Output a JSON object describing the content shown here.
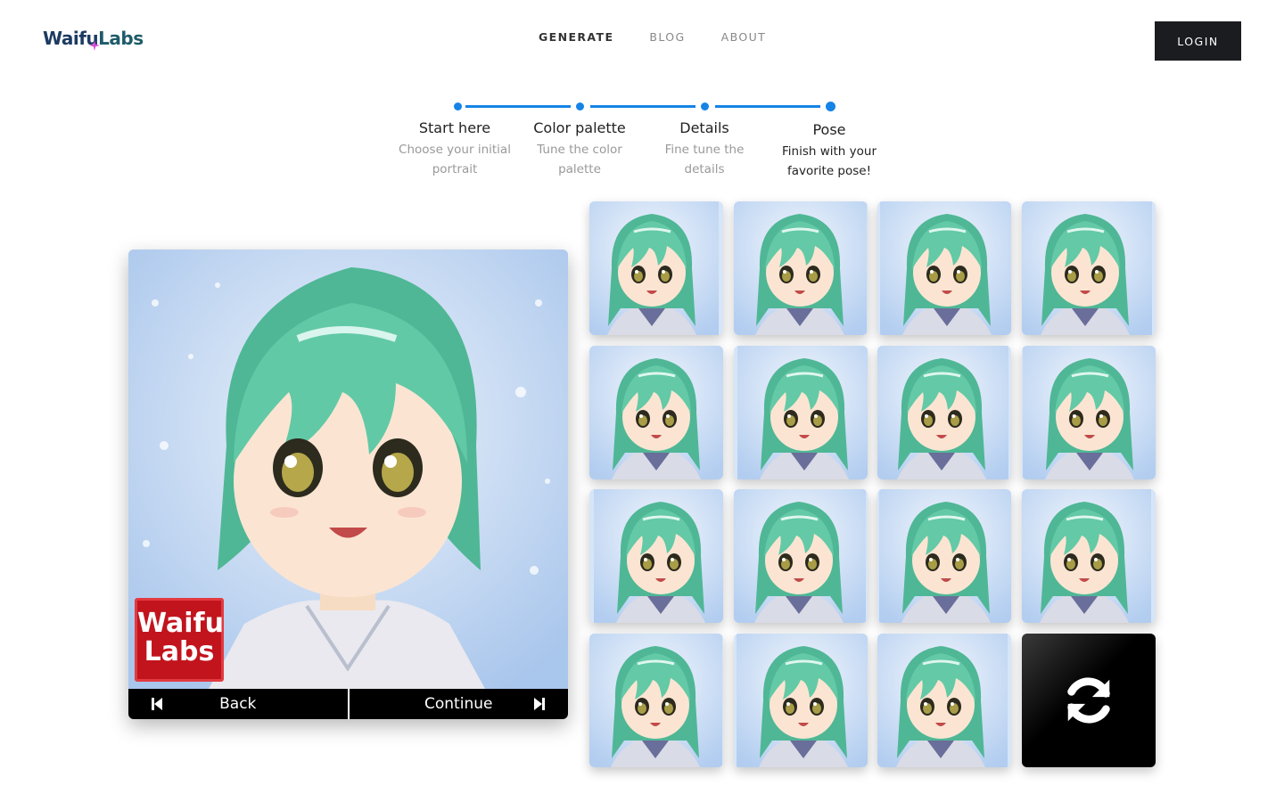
{
  "header": {
    "logo_text_a": "Waifu",
    "logo_text_b": "Labs",
    "nav": [
      {
        "label": "GENERATE",
        "active": true
      },
      {
        "label": "BLOG",
        "active": false
      },
      {
        "label": "ABOUT",
        "active": false
      }
    ],
    "login_label": "LOGIN"
  },
  "stepper": {
    "steps": [
      {
        "title": "Start here",
        "desc_1": "Choose your initial",
        "desc_2": "portrait"
      },
      {
        "title": "Color palette",
        "desc_1": "Tune the color",
        "desc_2": "palette"
      },
      {
        "title": "Details",
        "desc_1": "Fine tune the",
        "desc_2": "details"
      },
      {
        "title": "Pose",
        "desc_1": "Finish with your",
        "desc_2": "favorite pose!"
      }
    ],
    "current_step": 4,
    "accent_color": "#1683e6"
  },
  "portrait": {
    "watermark_line_1": "Waifu",
    "watermark_line_2": "Labs",
    "back_label": "Back",
    "continue_label": "Continue"
  },
  "grid": {
    "tile_count": 15,
    "refresh_icon": "refresh-icon",
    "hair_color": "#5cc4a2"
  }
}
